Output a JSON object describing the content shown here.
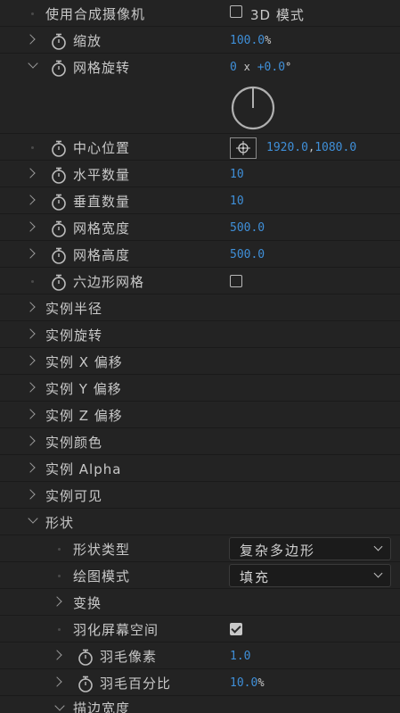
{
  "rows": {
    "use_camera": {
      "label": "使用合成摄像机",
      "check_label": "3D 模式",
      "checked": false
    },
    "scale": {
      "label": "缩放",
      "value": "100.0",
      "unit": "%"
    },
    "grid_rotation": {
      "label": "网格旋转",
      "revolutions": "0",
      "x": "x",
      "degrees": "+0.0",
      "deg_unit": "°",
      "dial_angle": 0
    },
    "center": {
      "label": "中心位置",
      "x": "1920.0",
      "sep": ",",
      "y": "1080.0"
    },
    "h_count": {
      "label": "水平数量",
      "value": "10"
    },
    "v_count": {
      "label": "垂直数量",
      "value": "10"
    },
    "grid_width": {
      "label": "网格宽度",
      "value": "500.0"
    },
    "grid_height": {
      "label": "网格高度",
      "value": "500.0"
    },
    "hex_grid": {
      "label": "六边形网格",
      "checked": false
    },
    "inst_radius": {
      "label": "实例半径"
    },
    "inst_rotation": {
      "label": "实例旋转"
    },
    "inst_x_offset": {
      "label": "实例 X 偏移"
    },
    "inst_y_offset": {
      "label": "实例 Y 偏移"
    },
    "inst_z_offset": {
      "label": "实例 Z 偏移"
    },
    "inst_color": {
      "label": "实例颜色"
    },
    "inst_alpha": {
      "label": "实例 Alpha"
    },
    "inst_visible": {
      "label": "实例可见"
    },
    "shape": {
      "label": "形状"
    },
    "shape_type": {
      "label": "形状类型",
      "value": "复杂多边形"
    },
    "draw_mode": {
      "label": "绘图模式",
      "value": "填充"
    },
    "transform": {
      "label": "变换"
    },
    "feather_screen": {
      "label": "羽化屏幕空间",
      "checked": true
    },
    "feather_px": {
      "label": "羽毛像素",
      "value": "1.0"
    },
    "feather_pct": {
      "label": "羽毛百分比",
      "value": "10.0",
      "unit": "%"
    },
    "stroke_width": {
      "label": "描边宽度"
    }
  },
  "colors": {
    "background": "#232323",
    "value_blue": "#3f8fd8",
    "text": "#c8c8c8"
  },
  "icons": [
    "stopwatch-icon",
    "chevron-right-icon",
    "chevron-down-icon",
    "checkbox-icon",
    "crosshair-icon",
    "dial-icon"
  ]
}
